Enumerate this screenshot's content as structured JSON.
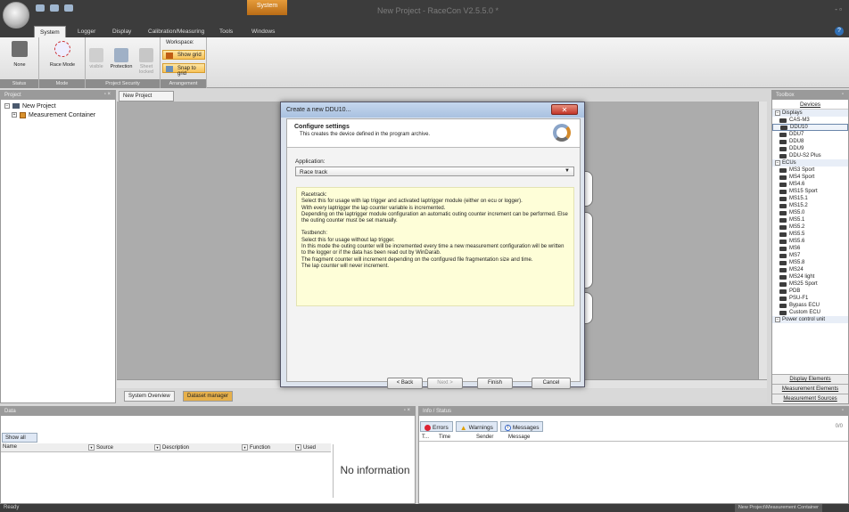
{
  "window": {
    "title": "New Project - RaceCon V2.5.5.0 *",
    "context_tab": "System",
    "controls": "-  ▫"
  },
  "menu_tabs": [
    "System",
    "Logger",
    "Display",
    "Calibration/Measuring",
    "Tools",
    "Windows"
  ],
  "ribbon": {
    "status": {
      "caption": "Status",
      "none_label": "None"
    },
    "mode": {
      "caption": "Mode",
      "race_mode_label": "Race Mode"
    },
    "security": {
      "caption": "Project Security",
      "visible_label": "visible",
      "protection_label": "Protection",
      "sheet_locked_label": "Sheet locked"
    },
    "arrangement": {
      "caption": "Arrangement",
      "workspace_label": "Workspace:",
      "show_grid": "Show grid",
      "snap_to_grid": "Snap to grid"
    }
  },
  "project_panel": {
    "title": "Project",
    "tree": [
      "New Project",
      "Measurement Container"
    ]
  },
  "document": {
    "tab": "New Project",
    "bottom_tabs": [
      "System Overview",
      "Dataset manager"
    ]
  },
  "dialog": {
    "title": "Create a new DDU10...",
    "header_title": "Configure settings",
    "header_subtitle": "This creates the device defined in the program archive.",
    "application_label": "Application:",
    "application_value": "Race track",
    "info_lines": [
      "Racetrack:",
      "Select this for usage with lap trigger and activated laptrigger module (either on ecu or logger).",
      "With every laptrigger the lap counter variable is incremented.",
      "Depending on the laptrigger module configuration an automatic outing counter increment can be performed. Else the outing counter must be set manually.",
      "",
      "Testbench:",
      "Select this for usage without lap trigger.",
      "In this mode the outing counter will be incremented every time a new measurement configuration will be written to the logger or if the data has been read out by WinDarab.",
      "The fragment counter will increment depending on the configured file fragmentation size and time.",
      "The lap counter will never increment."
    ],
    "buttons": {
      "back": "< Back",
      "next": "Next >",
      "finish": "Finish",
      "cancel": "Cancel"
    }
  },
  "toolbox": {
    "title": "Toolbox",
    "header": "Devices",
    "categories": [
      {
        "name": "Displays",
        "items": [
          "CAS-M3",
          "DDU10",
          "DDU7",
          "DDU8",
          "DDU9",
          "DDU-S2 Plus"
        ]
      },
      {
        "name": "ECUs",
        "items": [
          "MS3 Sport",
          "MS4 Sport",
          "MS4.6",
          "MS15 Sport",
          "MS15.1",
          "MS15.2",
          "MS5.0",
          "MS5.1",
          "MS5.2",
          "MS5.5",
          "MS5.6",
          "MS6",
          "MS7",
          "MS5.8",
          "MS24",
          "MS24 light",
          "MS25 Sport",
          "PDB",
          "PSU-F1",
          "Bypass ECU",
          "Custom ECU"
        ]
      },
      {
        "name": "Power control unit",
        "items": []
      }
    ],
    "selected": "DDU10",
    "footer": [
      "Display Elements",
      "Measurement Elements",
      "Measurement Sources"
    ]
  },
  "data_panel": {
    "title": "Data",
    "show_all": "Show all",
    "columns": [
      "Name",
      "Source",
      "Description",
      "Function",
      "Used"
    ],
    "empty": "No information"
  },
  "info_panel": {
    "title": "Info / Status",
    "tabs": [
      "Errors",
      "Warnings",
      "Messages"
    ],
    "count": "0/0",
    "columns": [
      "T...",
      "Time",
      "Sender",
      "Message"
    ]
  },
  "statusbar": {
    "left": "Ready",
    "path": "New Project\\Measurement Container"
  }
}
